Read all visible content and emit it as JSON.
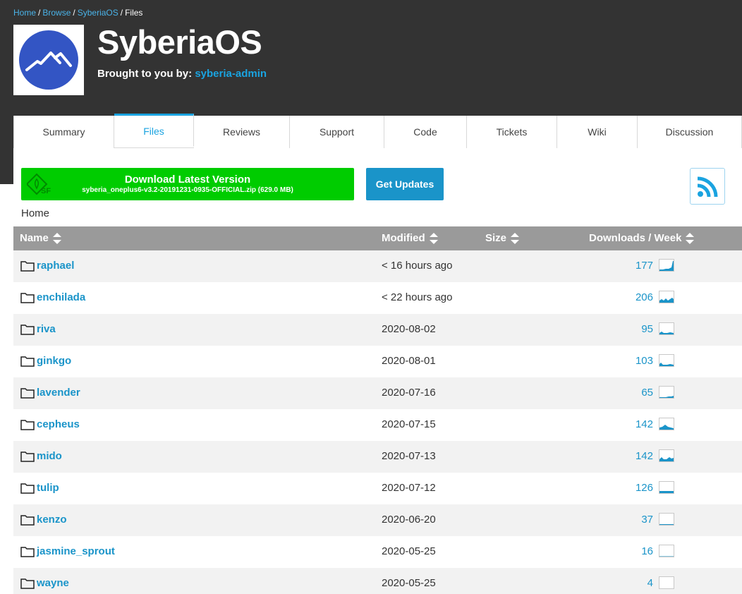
{
  "breadcrumb": {
    "items": [
      "Home",
      "Browse",
      "SyberiaOS"
    ],
    "current": "Files",
    "sep": "/"
  },
  "project": {
    "title": "SyberiaOS",
    "byline_prefix": "Brought to you by:",
    "author": "syberia-admin",
    "logo_color": "#3355c4"
  },
  "tabs": [
    {
      "label": "Summary",
      "active": false
    },
    {
      "label": "Files",
      "active": true
    },
    {
      "label": "Reviews",
      "active": false
    },
    {
      "label": "Support",
      "active": false
    },
    {
      "label": "Code",
      "active": false
    },
    {
      "label": "Tickets",
      "active": false
    },
    {
      "label": "Wiki",
      "active": false
    },
    {
      "label": "Discussion",
      "active": false
    }
  ],
  "download": {
    "title": "Download Latest Version",
    "file": "syberia_oneplus6-v3.2-20191231-0935-OFFICIAL.zip (629.0 MB)",
    "color": "#00cc00"
  },
  "updates_label": "Get Updates",
  "path": "Home",
  "table": {
    "headers": {
      "name": "Name",
      "modified": "Modified",
      "size": "Size",
      "downloads": "Downloads / Week"
    },
    "rows": [
      {
        "name": "raphael",
        "modified": "< 16 hours ago",
        "downloads": "177"
      },
      {
        "name": "enchilada",
        "modified": "< 22 hours ago",
        "downloads": "206"
      },
      {
        "name": "riva",
        "modified": "2020-08-02",
        "downloads": "95"
      },
      {
        "name": "ginkgo",
        "modified": "2020-08-01",
        "downloads": "103"
      },
      {
        "name": "lavender",
        "modified": "2020-07-16",
        "downloads": "65"
      },
      {
        "name": "cepheus",
        "modified": "2020-07-15",
        "downloads": "142"
      },
      {
        "name": "mido",
        "modified": "2020-07-13",
        "downloads": "142"
      },
      {
        "name": "tulip",
        "modified": "2020-07-12",
        "downloads": "126"
      },
      {
        "name": "kenzo",
        "modified": "2020-06-20",
        "downloads": "37"
      },
      {
        "name": "jasmine_sprout",
        "modified": "2020-05-25",
        "downloads": "16"
      },
      {
        "name": "wayne",
        "modified": "2020-05-25",
        "downloads": "4"
      }
    ]
  },
  "colors": {
    "header_bg": "#333333",
    "link": "#1a94c9",
    "table_header_bg": "#9a9a9a",
    "row_alt": "#f2f2f2"
  }
}
